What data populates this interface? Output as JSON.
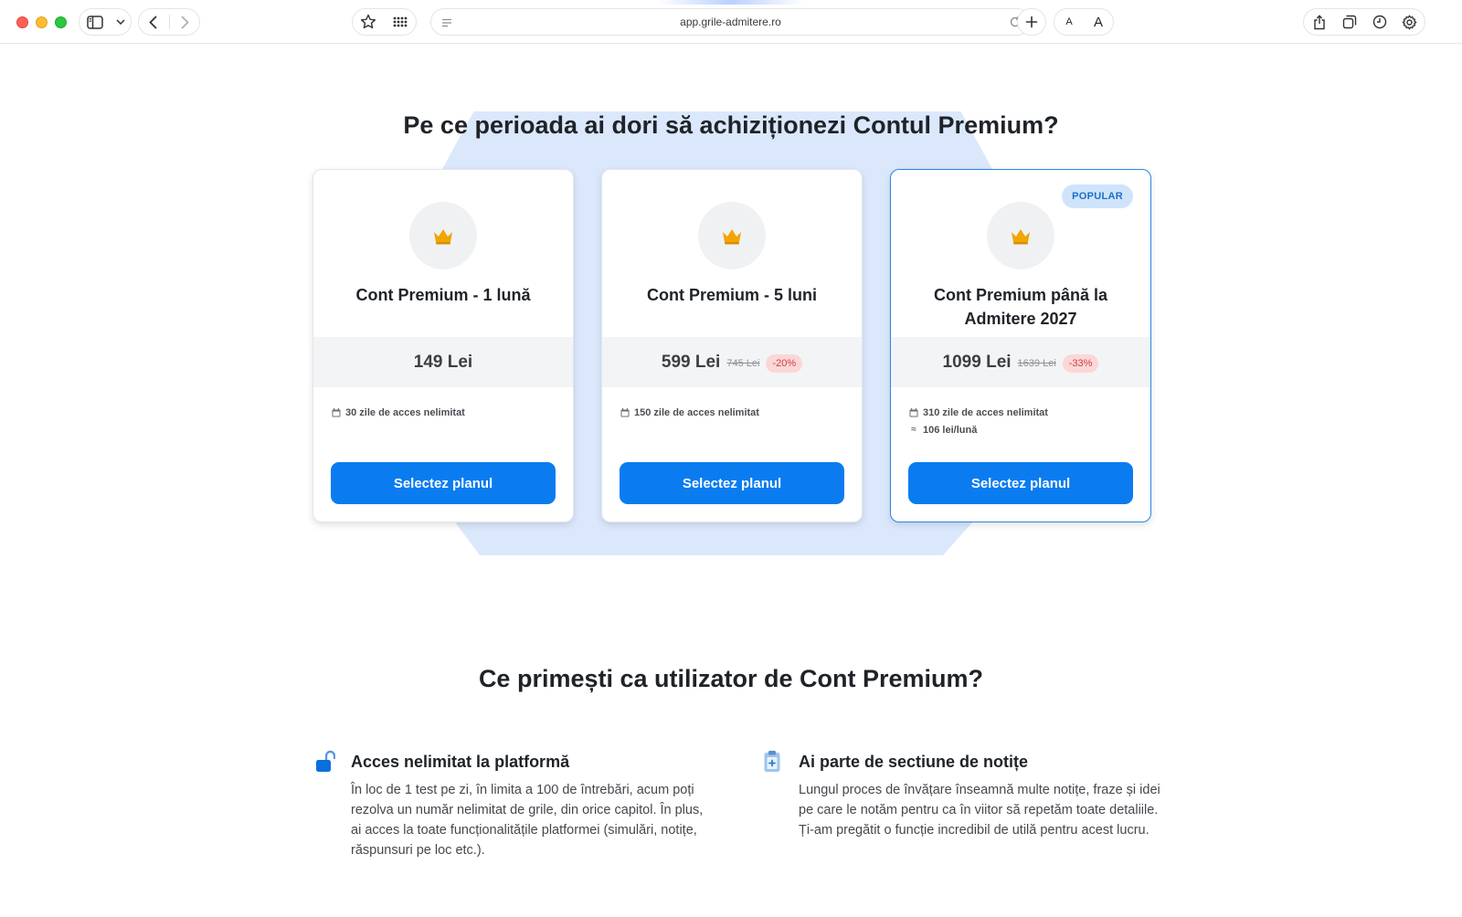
{
  "browser": {
    "url": "app.grile-admitere.ro",
    "font_small_label": "A",
    "font_large_label": "A"
  },
  "page": {
    "heading": "Pe ce perioada ai dori să achiziționezi Contul Premium?",
    "benefits_heading": "Ce primești ca utilizator de Cont Premium?"
  },
  "plans": [
    {
      "title": "Cont Premium - 1 lună",
      "price": "149 Lei",
      "old_price": "",
      "discount": "",
      "features": [
        "30 zile de acces nelimitat"
      ],
      "button": "Selectez planul"
    },
    {
      "title": "Cont Premium - 5 luni",
      "price": "599 Lei",
      "old_price": "745 Lei",
      "discount": "-20%",
      "features": [
        "150 zile de acces nelimitat"
      ],
      "button": "Selectez planul"
    },
    {
      "title": "Cont Premium până la Admitere 2027",
      "price": "1099 Lei",
      "old_price": "1639 Lei",
      "discount": "-33%",
      "badge": "POPULAR",
      "features": [
        "310 zile de acces nelimitat",
        "106 lei/lună"
      ],
      "button": "Selectez planul"
    }
  ],
  "benefits": [
    {
      "title": "Acces nelimitat la platformă",
      "text": "În loc de 1 test pe zi, în limita a 100 de întrebări, acum poți rezolva un număr nelimitat de grile, din orice capitol. În plus, ai acces la toate funcționalitățile platformei (simulări, notițe, răspunsuri pe loc etc.).",
      "icon": "unlock-icon"
    },
    {
      "title": "Ai parte de sectiune de notițe",
      "text": "Lungul proces de învățare înseamnă multe notițe, fraze și idei pe care le notăm pentru ca în viitor să repetăm toate detaliile. Ți-am pregătit o funcție incredibil de utilă pentru acest lucru.",
      "icon": "clipboard-icon"
    }
  ],
  "colors": {
    "accent": "#0a7cf0",
    "background_shape": "#dbe8fc",
    "crown": "#f0a500",
    "discount_text": "#d43b3b",
    "discount_bg": "#fbd7d7",
    "badge_bg": "#cfe4fb"
  }
}
